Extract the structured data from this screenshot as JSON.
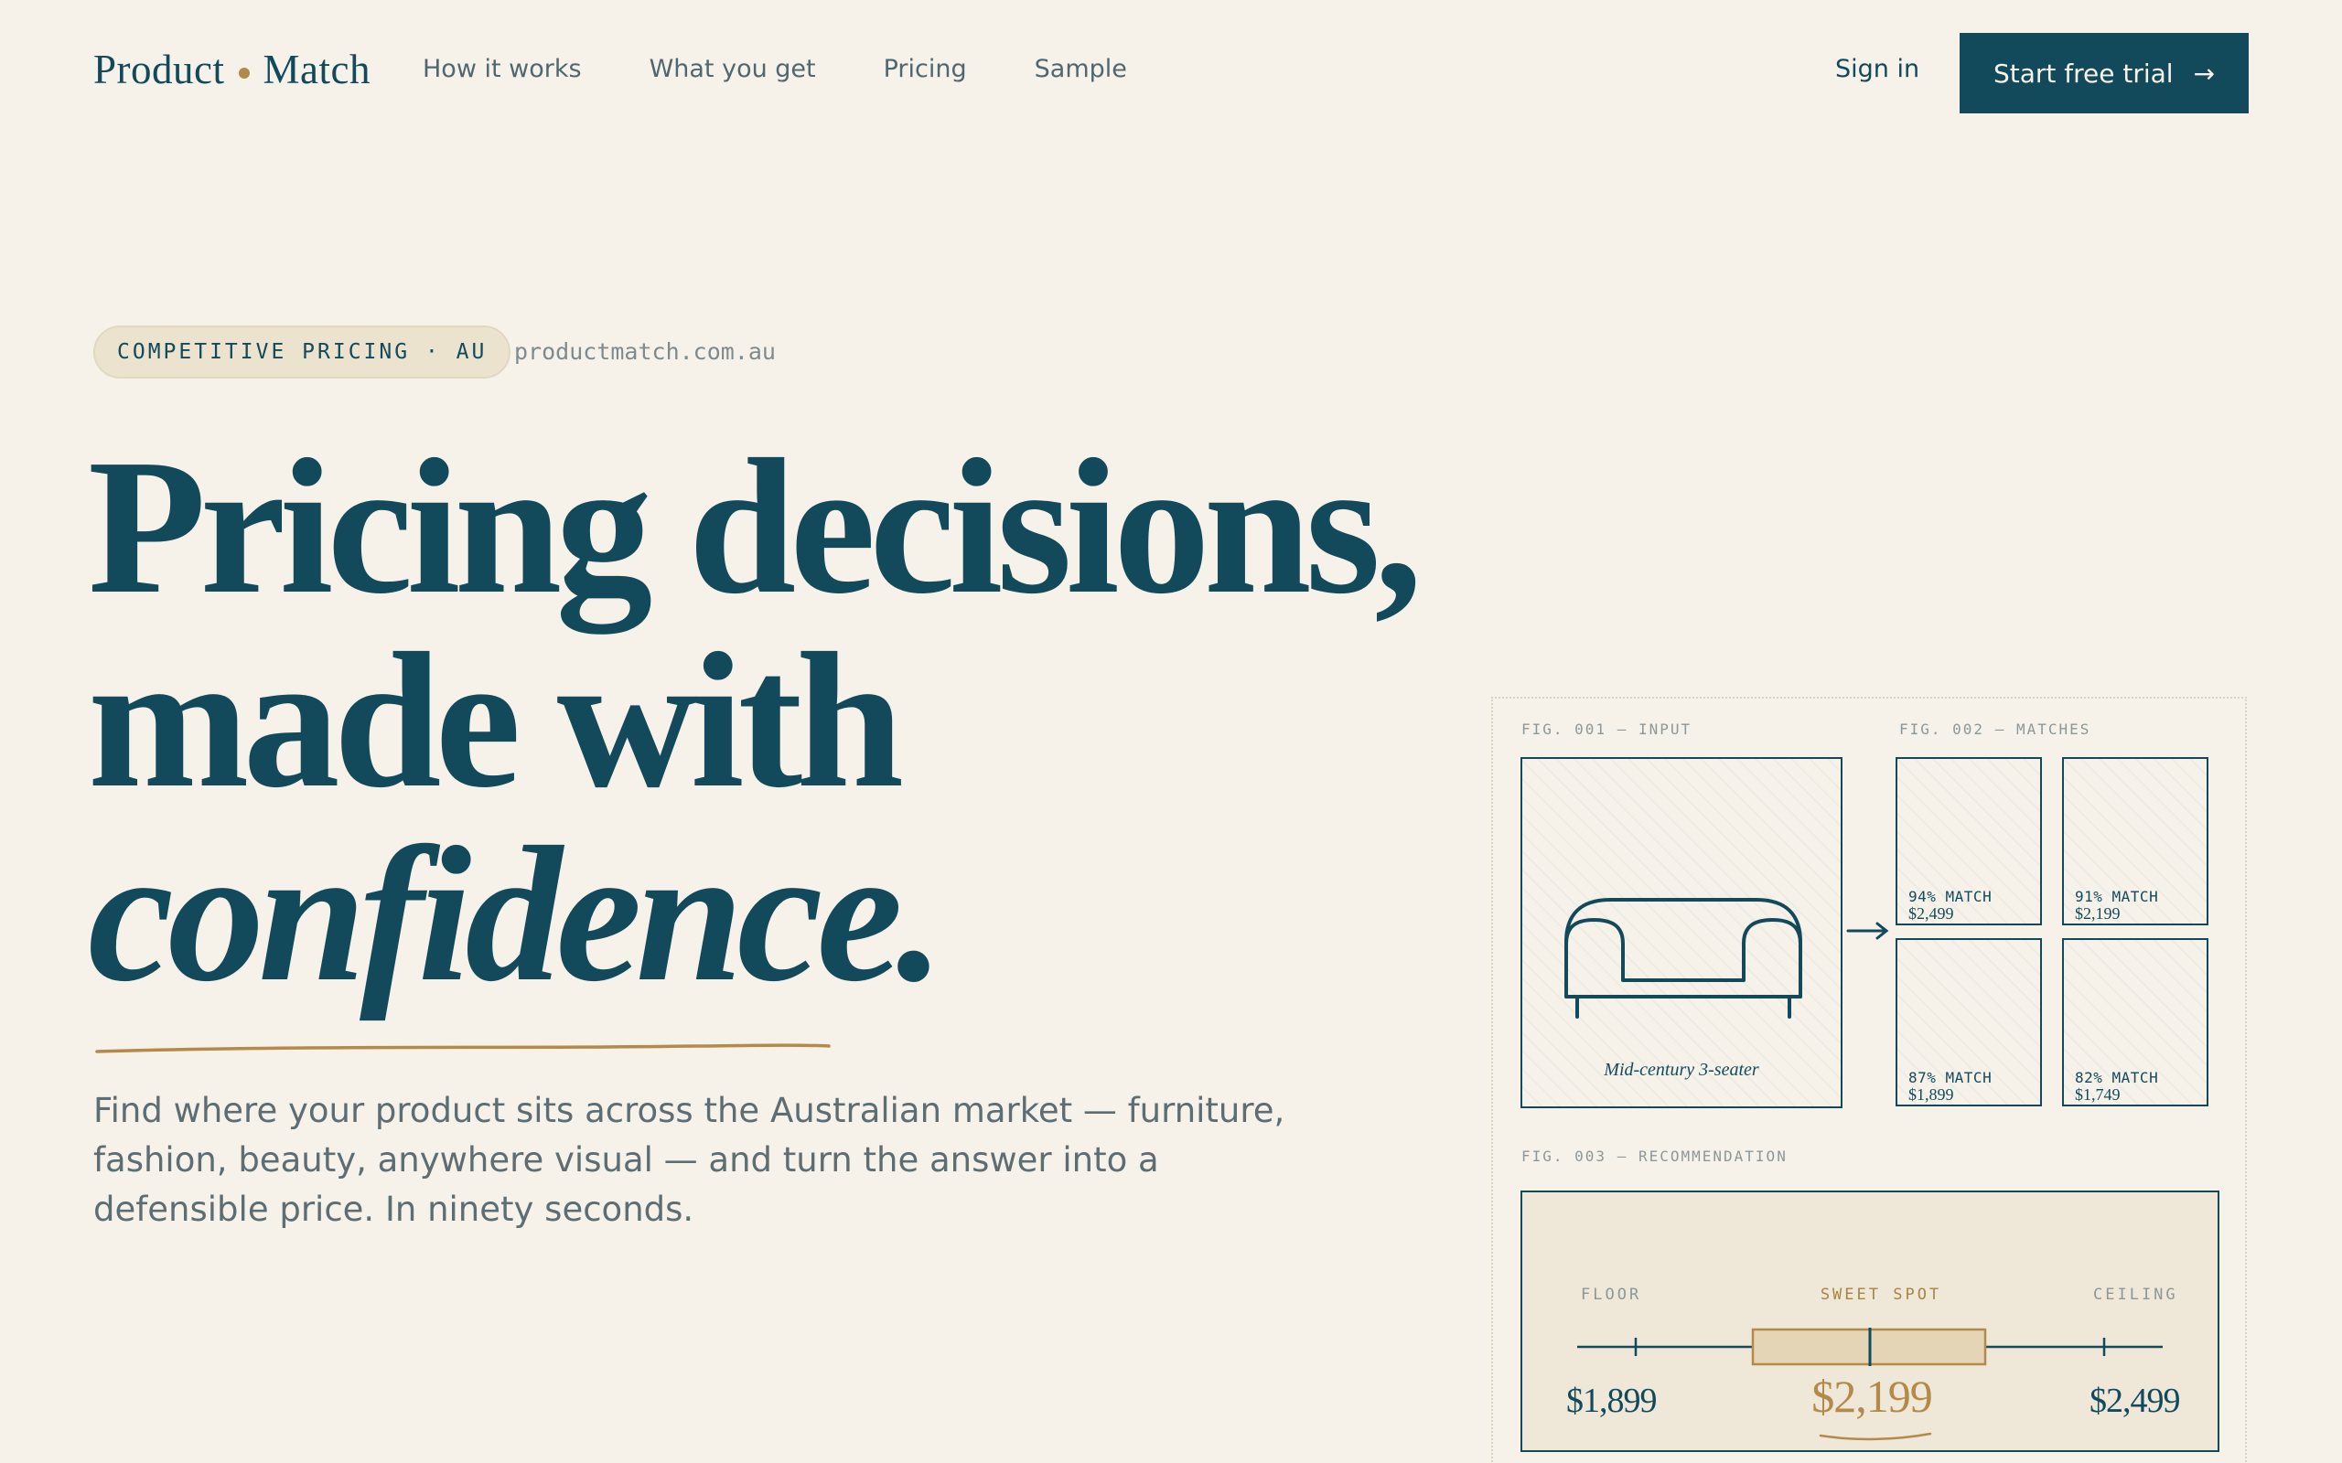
{
  "nav": {
    "logo_left": "Product",
    "logo_right": "Match",
    "links": [
      "How it works",
      "What you get",
      "Pricing",
      "Sample"
    ],
    "sign_in": "Sign in",
    "cta_label": "Start free trial",
    "cta_arrow": "→"
  },
  "hero": {
    "badge": "COMPETITIVE PRICING · AU",
    "domain": "productmatch.com.au",
    "headline_line1": "Pricing decisions,",
    "headline_line2": "made with",
    "headline_line3": "confidence.",
    "subcopy": "Find where your product sits across the Australian market — furniture, fashion, beauty, anywhere visual — and turn the answer into a defensible price. In ninety seconds."
  },
  "figures": {
    "input": {
      "label": "FIG. 001 — INPUT",
      "caption": "Mid-century 3-seater"
    },
    "matches": {
      "label": "FIG. 002 — MATCHES",
      "items": [
        {
          "pct": "94% MATCH",
          "price": "$2,499"
        },
        {
          "pct": "91% MATCH",
          "price": "$2,199"
        },
        {
          "pct": "87% MATCH",
          "price": "$1,899"
        },
        {
          "pct": "82% MATCH",
          "price": "$1,749"
        }
      ]
    },
    "recommendation": {
      "label": "FIG. 003 — RECOMMENDATION",
      "floor_label": "FLOOR",
      "sweet_label": "SWEET SPOT",
      "ceiling_label": "CEILING",
      "floor_price": "$1,899",
      "sweet_price": "$2,199",
      "ceiling_price": "$2,499"
    }
  },
  "colors": {
    "background": "#f6f2e9",
    "primary": "#124a5b",
    "accent": "#b38a4a"
  }
}
